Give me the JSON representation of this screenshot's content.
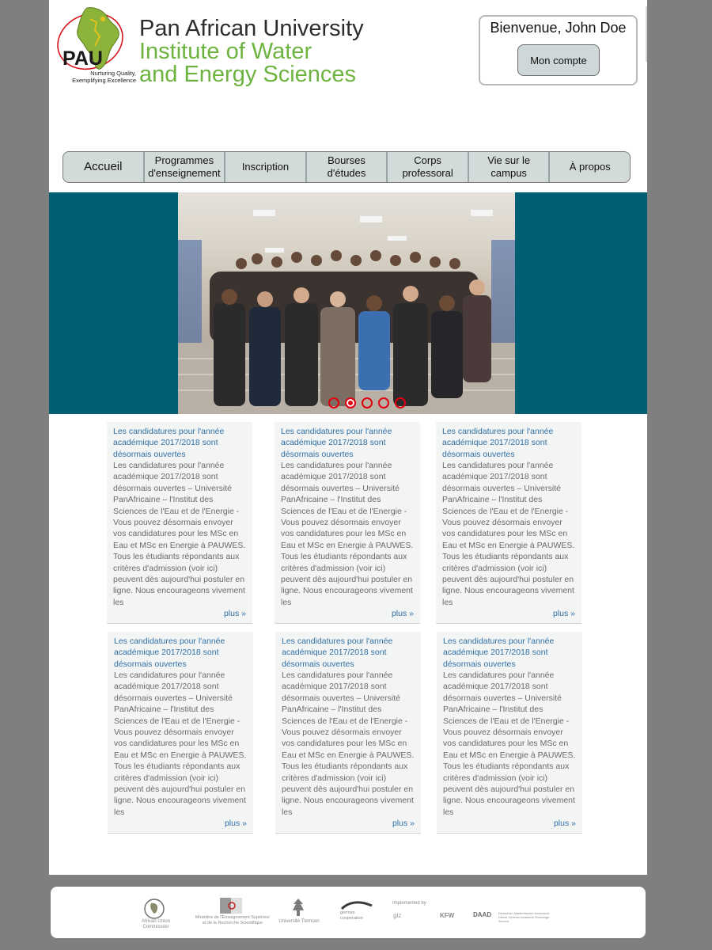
{
  "header": {
    "logo_abbr": "PAU",
    "logo_tagline": "Nurturing Quality, Exemplifying Excellence",
    "university_line1": "Pan African University",
    "university_line2": "Institute of Water",
    "university_line3": "and Energy Sciences"
  },
  "welcome": {
    "greeting": "Bienvenue, John Doe",
    "account_button": "Mon compte"
  },
  "nav": {
    "items": [
      {
        "label": "Accueil"
      },
      {
        "label": "Programmes d'enseignement"
      },
      {
        "label": "Inscription"
      },
      {
        "label": "Bourses d'études"
      },
      {
        "label": "Corps professoral"
      },
      {
        "label": "Vie sur le campus"
      },
      {
        "label": "À propos"
      }
    ]
  },
  "carousel": {
    "slide_count": 5,
    "active_index": 1
  },
  "news": {
    "cards": [
      {
        "title": "Les candidatures pour l'année académique 2017/2018 sont désormais ouvertes",
        "body": "Les candidatures pour l'année académique 2017/2018 sont désormais ouvertes – Université PanAfricaine – l'Institut des Sciences de l'Eau et de l'Energie - Vous pouvez désormais envoyer vos candidatures pour les MSc en Eau et MSc en Energie à PAUWES. Tous les étudiants répondants aux critères d'admission (voir ici) peuvent dès aujourd'hui postuler en ligne. Nous encourageons vivement les",
        "more": "plus »"
      },
      {
        "title": "Les candidatures pour l'année académique 2017/2018 sont désormais ouvertes",
        "body": "Les candidatures pour l'année académique 2017/2018 sont désormais ouvertes – Université PanAfricaine – l'Institut des Sciences de l'Eau et de l'Energie - Vous pouvez désormais envoyer vos candidatures pour les MSc en Eau et MSc en Energie à PAUWES. Tous les étudiants répondants aux critères d'admission (voir ici) peuvent dès aujourd'hui postuler en ligne. Nous encourageons vivement les",
        "more": "plus »"
      },
      {
        "title": "Les candidatures pour l'année académique 2017/2018 sont désormais ouvertes",
        "body": "Les candidatures pour l'année académique 2017/2018 sont désormais ouvertes – Université PanAfricaine – l'Institut des Sciences de l'Eau et de l'Energie - Vous pouvez désormais envoyer vos candidatures pour les MSc en Eau et MSc en Energie à PAUWES. Tous les étudiants répondants aux critères d'admission (voir ici) peuvent dès aujourd'hui postuler en ligne. Nous encourageons vivement les",
        "more": "plus »"
      },
      {
        "title": "Les candidatures pour l'année académique 2017/2018 sont désormais ouvertes",
        "body": "Les candidatures pour l'année académique 2017/2018 sont désormais ouvertes – Université PanAfricaine – l'Institut des Sciences de l'Eau et de l'Energie - Vous pouvez désormais envoyer vos candidatures pour les MSc en Eau et MSc en Energie à PAUWES. Tous les étudiants répondants aux critères d'admission (voir ici) peuvent dès aujourd'hui postuler en ligne. Nous encourageons vivement les",
        "more": "plus »"
      },
      {
        "title": "Les candidatures pour l'année académique 2017/2018 sont désormais ouvertes",
        "body": "Les candidatures pour l'année académique 2017/2018 sont désormais ouvertes – Université PanAfricaine – l'Institut des Sciences de l'Eau et de l'Energie - Vous pouvez désormais envoyer vos candidatures pour les MSc en Eau et MSc en Energie à PAUWES. Tous les étudiants répondants aux critères d'admission (voir ici) peuvent dès aujourd'hui postuler en ligne. Nous encourageons vivement les",
        "more": "plus »"
      },
      {
        "title": "Les candidatures pour l'année académique 2017/2018 sont désormais ouvertes",
        "body": "Les candidatures pour l'année académique 2017/2018 sont désormais ouvertes – Université PanAfricaine – l'Institut des Sciences de l'Eau et de l'Energie - Vous pouvez désormais envoyer vos candidatures pour les MSc en Eau et MSc en Energie à PAUWES. Tous les étudiants répondants aux critères d'admission (voir ici) peuvent dès aujourd'hui postuler en ligne. Nous encourageons vivement les",
        "more": "plus »"
      }
    ]
  },
  "footer": {
    "partners": [
      {
        "name": "African Union Commission"
      },
      {
        "name": "Ministère de l'Enseignement Supérieur et de la Recherche Scientifique"
      },
      {
        "name": "Université Tlemcen"
      },
      {
        "name": "german cooperation"
      },
      {
        "name": "Implemented by"
      },
      {
        "name": "giz"
      },
      {
        "name": "KFW"
      },
      {
        "name": "DAAD"
      },
      {
        "name": "Deutscher Akademischer Austausch Dienst German Academic Exchange Service"
      }
    ]
  },
  "colors": {
    "page_background": "#7f7f7f",
    "banner_background": "#005f73",
    "accent_green": "#6db33f",
    "link_blue": "#2f6fa3",
    "carousel_dot": "#e1000f",
    "nav_background": "#d2dada"
  },
  "icons": {
    "logo": "africa-map-emblem-icon",
    "carousel_dot": "circle-icon"
  }
}
